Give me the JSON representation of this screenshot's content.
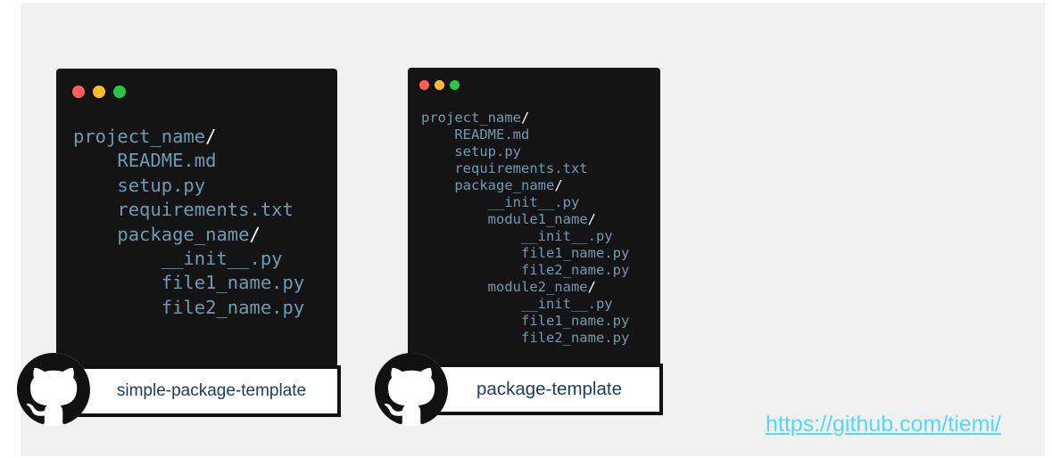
{
  "colors": {
    "canvas_bg": "#f1f1f1",
    "terminal_bg": "#141414",
    "code_text": "#6f9bb2",
    "label_text": "#1c3d66",
    "link": "#4ddbff"
  },
  "cards": [
    {
      "icon": "github-icon",
      "window_controls": [
        "close-dot",
        "minimize-dot",
        "maximize-dot"
      ],
      "lines": [
        {
          "indent": 0,
          "text": "project_name",
          "slash": "/"
        },
        {
          "indent": 4,
          "text": "README.md",
          "slash": ""
        },
        {
          "indent": 4,
          "text": "setup.py",
          "slash": ""
        },
        {
          "indent": 4,
          "text": "requirements.txt",
          "slash": ""
        },
        {
          "indent": 4,
          "text": "package_name",
          "slash": "/"
        },
        {
          "indent": 8,
          "text": "__init__.py",
          "slash": ""
        },
        {
          "indent": 8,
          "text": "file1_name.py",
          "slash": ""
        },
        {
          "indent": 8,
          "text": "file2_name.py",
          "slash": ""
        }
      ],
      "label": "simple-package-template"
    },
    {
      "icon": "github-icon",
      "window_controls": [
        "close-dot",
        "minimize-dot",
        "maximize-dot"
      ],
      "lines": [
        {
          "indent": 0,
          "text": "project_name",
          "slash": "/"
        },
        {
          "indent": 4,
          "text": "README.md",
          "slash": ""
        },
        {
          "indent": 4,
          "text": "setup.py",
          "slash": ""
        },
        {
          "indent": 4,
          "text": "requirements.txt",
          "slash": ""
        },
        {
          "indent": 4,
          "text": "package_name",
          "slash": "/"
        },
        {
          "indent": 8,
          "text": "__init__.py",
          "slash": ""
        },
        {
          "indent": 8,
          "text": "module1_name",
          "slash": "/"
        },
        {
          "indent": 12,
          "text": "__init__.py",
          "slash": ""
        },
        {
          "indent": 12,
          "text": "file1_name.py",
          "slash": ""
        },
        {
          "indent": 12,
          "text": "file2_name.py",
          "slash": ""
        },
        {
          "indent": 8,
          "text": "module2_name",
          "slash": "/"
        },
        {
          "indent": 12,
          "text": "__init__.py",
          "slash": ""
        },
        {
          "indent": 12,
          "text": "file1_name.py",
          "slash": ""
        },
        {
          "indent": 12,
          "text": "file2_name.py",
          "slash": ""
        }
      ],
      "label": "package-template"
    }
  ],
  "link": {
    "text": "https://github.com/tiemi/"
  }
}
